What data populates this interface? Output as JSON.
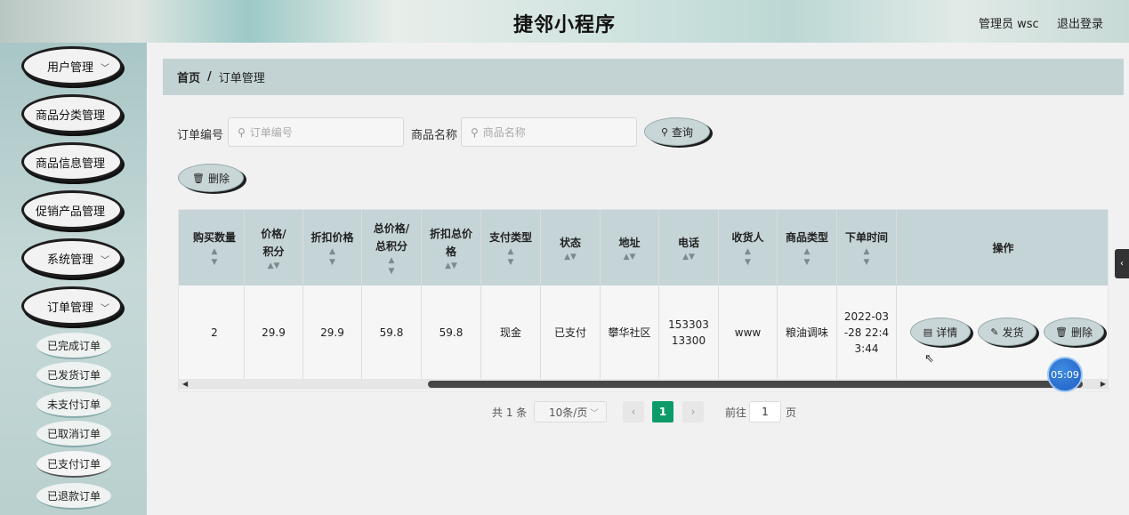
{
  "header": {
    "title": "捷邻小程序",
    "admin": "管理员 wsc",
    "logout": "退出登录"
  },
  "sidebar": {
    "menus": [
      {
        "label": "用户管理",
        "chevron": "﹀"
      },
      {
        "label": "商品分类管理",
        "chevron": ""
      },
      {
        "label": "商品信息管理",
        "chevron": ""
      },
      {
        "label": "促销产品管理",
        "chevron": ""
      },
      {
        "label": "系统管理",
        "chevron": "﹀"
      },
      {
        "label": "订单管理",
        "chevron": "﹀"
      }
    ],
    "submenu": [
      {
        "label": "已完成订单"
      },
      {
        "label": "已发货订单"
      },
      {
        "label": "未支付订单"
      },
      {
        "label": "已取消订单"
      },
      {
        "label": "已支付订单",
        "active": true
      },
      {
        "label": "已退款订单"
      }
    ]
  },
  "breadcrumb": {
    "home": "首页",
    "sep": "/",
    "current": "订单管理"
  },
  "search": {
    "order_no_label": "订单编号",
    "order_no_placeholder": "订单编号",
    "product_label": "商品名称",
    "product_placeholder": "商品名称",
    "query_button": "查询",
    "delete_button": "删除"
  },
  "table": {
    "headers": [
      "购买数量",
      "价格/积分",
      "折扣价格",
      "总价格/总积分",
      "折扣总价格",
      "支付类型",
      "状态",
      "地址",
      "电话",
      "收货人",
      "商品类型",
      "下单时间",
      "操作"
    ],
    "row": {
      "qty": "2",
      "price": "29.9",
      "discount": "29.9",
      "total": "59.8",
      "discount_total": "59.8",
      "pay_type": "现金",
      "status": "已支付",
      "address": "攀华社区",
      "phone": "15330313300",
      "receiver": "www",
      "category": "粮油调味",
      "time": "2022-03-28 22:43:44"
    },
    "actions": {
      "detail": "详情",
      "ship": "发货",
      "delete": "删除"
    }
  },
  "pagination": {
    "total": "共 1 条",
    "page_size": "10条/页",
    "current": "1",
    "goto_label": "前往",
    "goto_value": "1",
    "page_unit": "页"
  },
  "overlay": {
    "timer": "05:09"
  },
  "icons": {
    "search": "search-icon",
    "delete": "trash-icon",
    "detail": "document-icon",
    "ship": "edit-icon",
    "sort": "sort-icon"
  },
  "colors": {
    "accent": "#0e9b6a",
    "header_row": "#c5d4d7",
    "breadcrumb": "#c3d3d3"
  }
}
